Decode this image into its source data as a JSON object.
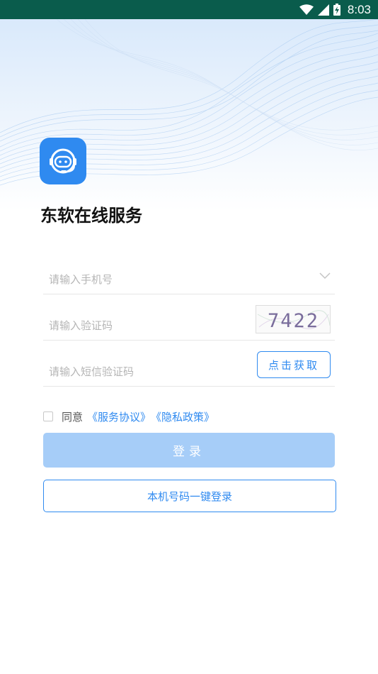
{
  "status_bar": {
    "time": "8:03",
    "icons": [
      "wifi-icon",
      "cellular-signal-icon",
      "battery-charging-icon"
    ]
  },
  "app": {
    "name": "东软在线服务",
    "logo_icon": "customer-service-robot-icon",
    "brand_color": "#2f8af0"
  },
  "form": {
    "phone_placeholder": "请输入手机号",
    "captcha_placeholder": "请输入验证码",
    "captcha_text": "7422",
    "sms_placeholder": "请输入短信验证码",
    "sms_button": "点击获取"
  },
  "agreement": {
    "checked": false,
    "prefix": "同意",
    "terms_link": "《服务协议》",
    "privacy_link": "《隐私政策》"
  },
  "buttons": {
    "login": "登录",
    "one_key_login": "本机号码一键登录"
  }
}
